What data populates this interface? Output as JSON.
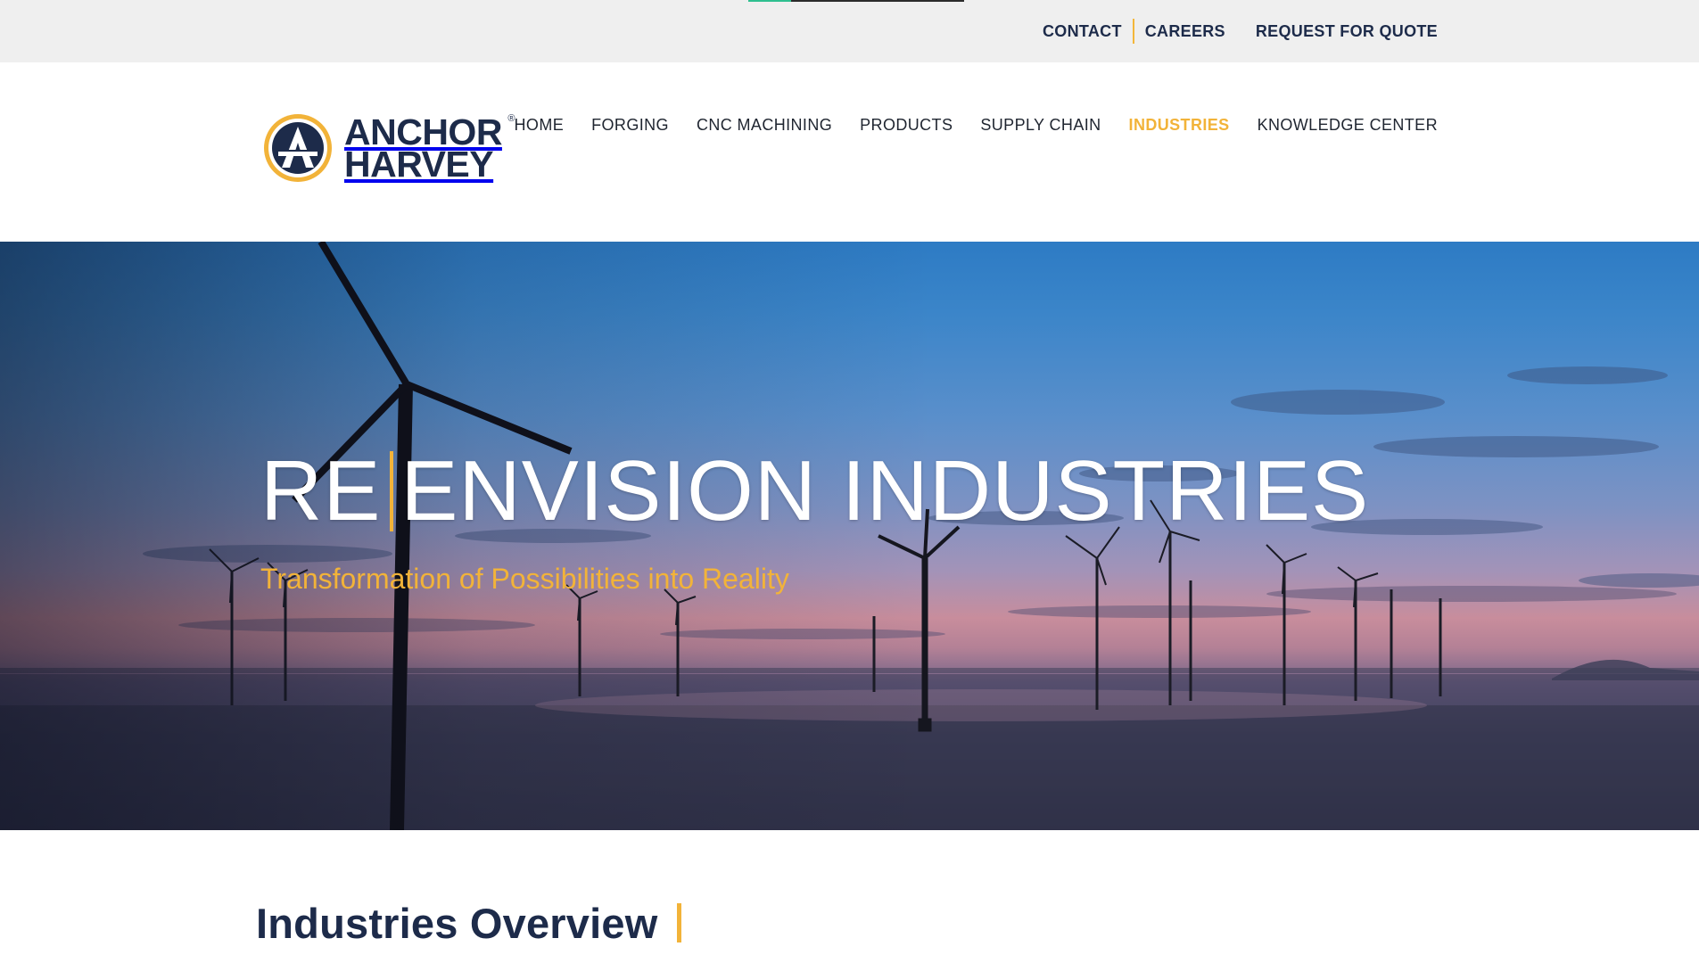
{
  "utility_bar": {
    "links": [
      "CONTACT",
      "CAREERS",
      "REQUEST FOR QUOTE"
    ],
    "scroll_progress": 0.2,
    "colors": {
      "background": "#efefef",
      "progress_fill": "#2fbf8f",
      "divider": "#f3b63a"
    }
  },
  "logo": {
    "line1": "ANCHOR",
    "line2": "HARVEY",
    "registered": "®",
    "icon": "anchor-harvey-emblem-icon"
  },
  "main_nav": {
    "items": [
      {
        "label": "HOME"
      },
      {
        "label": "FORGING"
      },
      {
        "label": "CNC MACHINING"
      },
      {
        "label": "PRODUCTS"
      },
      {
        "label": "SUPPLY CHAIN"
      },
      {
        "label": "INDUSTRIES",
        "active": true
      },
      {
        "label": "KNOWLEDGE CENTER"
      }
    ],
    "colors": {
      "text": "#1f2530",
      "active": "#f2b339"
    }
  },
  "hero": {
    "title_part1": "RE",
    "title_part2": "ENVISION INDUSTRIES",
    "subtitle": "Transformation of Possibilities into Reality",
    "image": "offshore-wind-turbines-at-sunset",
    "colors": {
      "accent": "#f2b339",
      "title": "#ffffff"
    }
  },
  "section": {
    "title": "Industries Overview"
  },
  "brand_colors": {
    "navy": "#1d2b4a",
    "gold": "#f2b339"
  }
}
